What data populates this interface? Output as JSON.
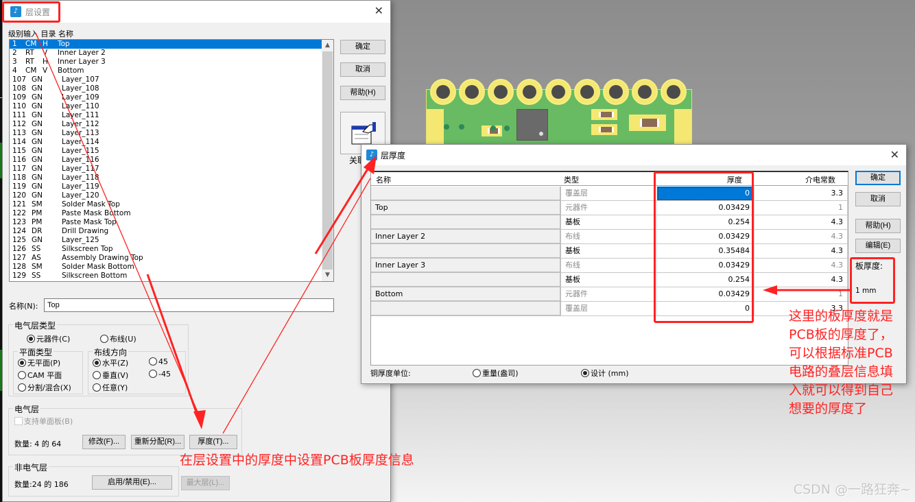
{
  "layer_setup": {
    "title": "层设置",
    "column_header": "级别输入  目录  名称",
    "layers": [
      {
        "level": "1",
        "type": "CM",
        "dir": "H",
        "name": "Top"
      },
      {
        "level": "2",
        "type": "RT",
        "dir": "V",
        "name": "Inner Layer 2"
      },
      {
        "level": "3",
        "type": "RT",
        "dir": "H",
        "name": "Inner Layer 3"
      },
      {
        "level": "4",
        "type": "CM",
        "dir": "V",
        "name": "Bottom"
      },
      {
        "level": "107",
        "type": "GN",
        "dir": "",
        "name": "Layer_107"
      },
      {
        "level": "108",
        "type": "GN",
        "dir": "",
        "name": "Layer_108"
      },
      {
        "level": "109",
        "type": "GN",
        "dir": "",
        "name": "Layer_109"
      },
      {
        "level": "110",
        "type": "GN",
        "dir": "",
        "name": "Layer_110"
      },
      {
        "level": "111",
        "type": "GN",
        "dir": "",
        "name": "Layer_111"
      },
      {
        "level": "112",
        "type": "GN",
        "dir": "",
        "name": "Layer_112"
      },
      {
        "level": "113",
        "type": "GN",
        "dir": "",
        "name": "Layer_113"
      },
      {
        "level": "114",
        "type": "GN",
        "dir": "",
        "name": "Layer_114"
      },
      {
        "level": "115",
        "type": "GN",
        "dir": "",
        "name": "Layer_115"
      },
      {
        "level": "116",
        "type": "GN",
        "dir": "",
        "name": "Layer_116"
      },
      {
        "level": "117",
        "type": "GN",
        "dir": "",
        "name": "Layer_117"
      },
      {
        "level": "118",
        "type": "GN",
        "dir": "",
        "name": "Layer_118"
      },
      {
        "level": "119",
        "type": "GN",
        "dir": "",
        "name": "Layer_119"
      },
      {
        "level": "120",
        "type": "GN",
        "dir": "",
        "name": "Layer_120"
      },
      {
        "level": "121",
        "type": "SM",
        "dir": "",
        "name": "Solder Mask Top"
      },
      {
        "level": "122",
        "type": "PM",
        "dir": "",
        "name": "Paste Mask Bottom"
      },
      {
        "level": "123",
        "type": "PM",
        "dir": "",
        "name": "Paste Mask Top"
      },
      {
        "level": "124",
        "type": "DR",
        "dir": "",
        "name": "Drill Drawing"
      },
      {
        "level": "125",
        "type": "GN",
        "dir": "",
        "name": "Layer_125"
      },
      {
        "level": "126",
        "type": "SS",
        "dir": "",
        "name": "Silkscreen Top"
      },
      {
        "level": "127",
        "type": "AS",
        "dir": "",
        "name": "Assembly Drawing Top"
      },
      {
        "level": "128",
        "type": "SM",
        "dir": "",
        "name": "Solder Mask Bottom"
      },
      {
        "level": "129",
        "type": "SS",
        "dir": "",
        "name": "Silkscreen Bottom"
      }
    ],
    "selected_index": 0,
    "buttons": {
      "ok": "确定",
      "cancel": "取消",
      "help": "帮助(H)",
      "associate": "关联"
    },
    "name_label": "名称(N):",
    "name_value": "Top",
    "electrical_type": {
      "title": "电气层类型",
      "component": "元器件(C)",
      "routing": "布线(U)",
      "selected": "component"
    },
    "plane_type": {
      "title": "平面类型",
      "options": [
        "无平面(P)",
        "CAM 平面",
        "分割/混合(X)"
      ],
      "selected": 0
    },
    "routing_direction": {
      "title": "布线方向",
      "options": [
        "水平(Z)",
        "垂直(V)",
        "任意(Y)",
        "45",
        "-45"
      ],
      "selected": 0
    },
    "electrical": {
      "title": "电气层",
      "single_sided": "支持单面板(B)",
      "count": "数量: 4 的 64",
      "modify": "修改(F)...",
      "reassign": "重新分配(R)...",
      "thickness": "厚度(T)..."
    },
    "non_electrical": {
      "title": "非电气层",
      "count": "数量:24 的 186",
      "enable": "启用/禁用(E)...",
      "max_layers": "最大层(L)..."
    }
  },
  "layer_thickness": {
    "title": "层厚度",
    "columns": {
      "name": "名称",
      "type": "类型",
      "thickness": "厚度",
      "dielectric": "介电常数"
    },
    "rows": [
      {
        "name": "",
        "type": "覆盖层",
        "thickness": "0",
        "dielectric": "3.3",
        "type_muted": true,
        "diel_muted": false
      },
      {
        "name": "Top",
        "type": "元器件",
        "thickness": "0.03429",
        "dielectric": "1",
        "type_muted": true,
        "diel_muted": true
      },
      {
        "name": "",
        "type": "基板",
        "thickness": "0.254",
        "dielectric": "4.3",
        "type_muted": false,
        "diel_muted": false
      },
      {
        "name": "Inner Layer 2",
        "type": "布线",
        "thickness": "0.03429",
        "dielectric": "4.3",
        "type_muted": true,
        "diel_muted": true
      },
      {
        "name": "",
        "type": "基板",
        "thickness": "0.35484",
        "dielectric": "4.3",
        "type_muted": false,
        "diel_muted": false
      },
      {
        "name": "Inner Layer 3",
        "type": "布线",
        "thickness": "0.03429",
        "dielectric": "4.3",
        "type_muted": true,
        "diel_muted": true
      },
      {
        "name": "",
        "type": "基板",
        "thickness": "0.254",
        "dielectric": "4.3",
        "type_muted": false,
        "diel_muted": false
      },
      {
        "name": "Bottom",
        "type": "元器件",
        "thickness": "0.03429",
        "dielectric": "1",
        "type_muted": true,
        "diel_muted": true
      },
      {
        "name": "",
        "type": "覆盖层",
        "thickness": "0",
        "dielectric": "3.3",
        "type_muted": true,
        "diel_muted": false
      }
    ],
    "buttons": {
      "ok": "确定",
      "cancel": "取消",
      "help": "帮助(H)",
      "edit": "编辑(E)"
    },
    "board_thickness_label": "板厚度:",
    "board_thickness_value": "1 mm",
    "copper_unit_label": "铜厚度单位:",
    "copper_unit_options": [
      "重量(盎司)",
      "设计 (mm)"
    ],
    "copper_unit_selected": 1
  },
  "annotations": {
    "bottom_note": "在层设置中的厚度中设置PCB板厚度信息",
    "right_note": [
      "这里的板厚度就是",
      "PCB板的厚度了，",
      "可以根据标准PCB",
      "电路的叠层信息填",
      "入就可以得到自己",
      "想要的厚度了"
    ],
    "color": "#ff2222"
  },
  "watermark": "CSDN @一路狂奔~"
}
